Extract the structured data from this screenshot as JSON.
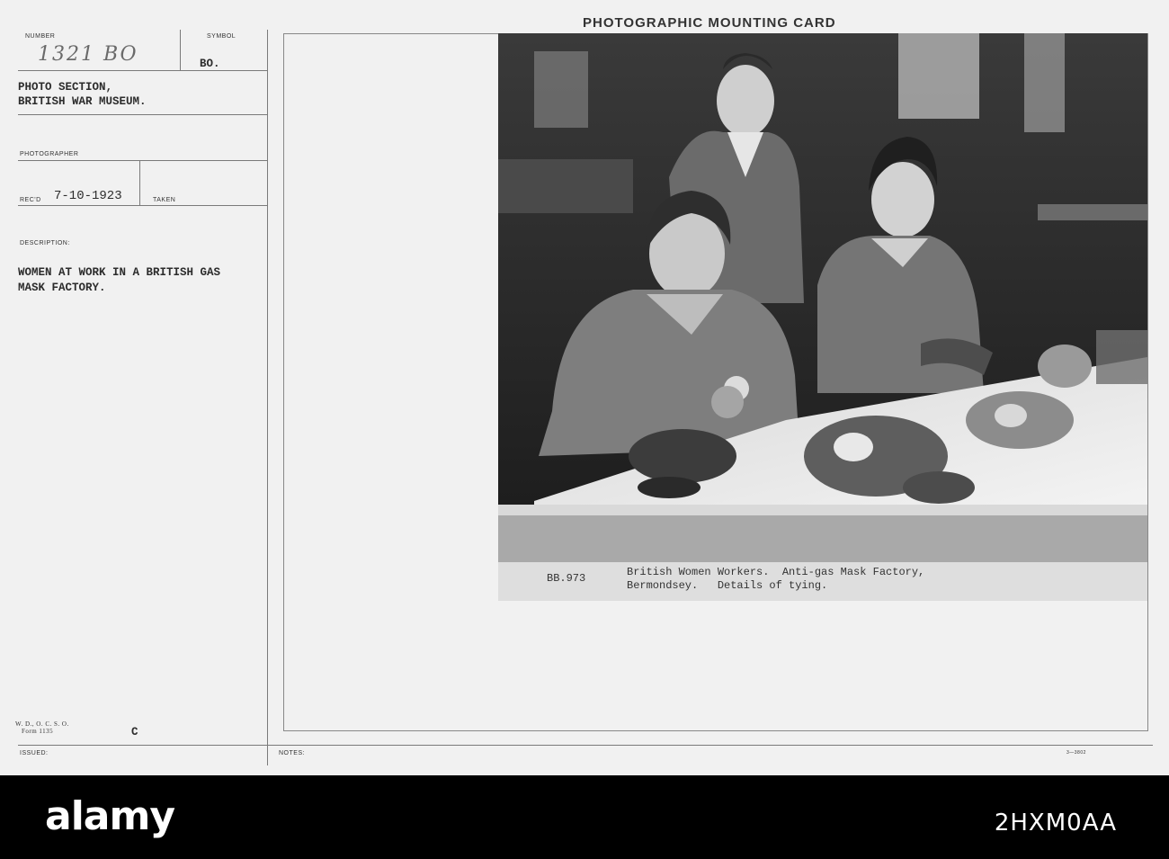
{
  "card": {
    "title": "PHOTOGRAPHIC MOUNTING CARD",
    "number_label": "NUMBER",
    "number_value": "1321 BO",
    "symbol_label": "SYMBOL",
    "symbol_value": "BO.",
    "section_line1": "PHOTO SECTION,",
    "section_line2": "BRITISH WAR MUSEUM.",
    "photographer_label": "PHOTOGRAPHER",
    "recd_label": "REC'D",
    "recd_value": "7-10-1923",
    "taken_label": "TAKEN",
    "description_label": "DESCRIPTION:",
    "description_line1": "WOMEN AT WORK IN A BRITISH GAS",
    "description_line2": "MASK FACTORY.",
    "form_line1": "W. D., O. C. S. O.",
    "form_line2": "Form 1135",
    "form_letter": "C",
    "issued_label": "ISSUED:",
    "notes_label": "NOTES:",
    "print_code": "3—3802"
  },
  "photo": {
    "caption_code": "BB.973",
    "caption_line1": "British Women Workers.  Anti-gas Mask Factory,",
    "caption_line2": "Bermondsey.   Details of tying."
  },
  "watermark": {
    "brand": "alamy",
    "image_id": "2HXM0AA"
  }
}
